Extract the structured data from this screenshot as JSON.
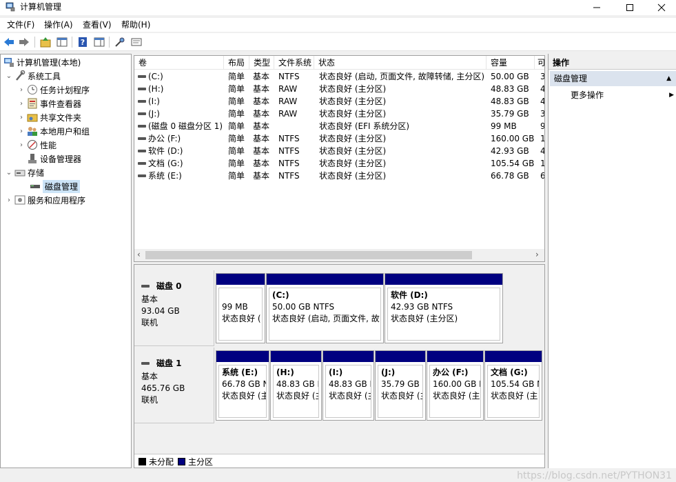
{
  "window": {
    "title": "计算机管理",
    "icon": "computer-management-icon"
  },
  "menu": [
    "文件(F)",
    "操作(A)",
    "查看(V)",
    "帮助(H)"
  ],
  "toolbar": [
    "back-arrow-icon",
    "forward-arrow-icon",
    "up-folder-icon",
    "show-tree-icon",
    "help-icon",
    "show-action-pane-icon",
    "connect-icon",
    "properties-icon"
  ],
  "tree": {
    "root": "计算机管理(本地)",
    "system_tools": "系统工具",
    "task_scheduler": "任务计划程序",
    "event_viewer": "事件查看器",
    "shared_folders": "共享文件夹",
    "local_users": "本地用户和组",
    "performance": "性能",
    "device_manager": "设备管理器",
    "storage": "存储",
    "disk_management": "磁盘管理",
    "services": "服务和应用程序"
  },
  "volumes": {
    "headers": [
      "卷",
      "布局",
      "类型",
      "文件系统",
      "状态",
      "容量",
      "可"
    ],
    "rows": [
      [
        "(C:)",
        "简单",
        "基本",
        "NTFS",
        "状态良好 (启动, 页面文件, 故障转储, 主分区)",
        "50.00 GB",
        "3"
      ],
      [
        "(H:)",
        "简单",
        "基本",
        "RAW",
        "状态良好 (主分区)",
        "48.83 GB",
        "4"
      ],
      [
        "(I:)",
        "简单",
        "基本",
        "RAW",
        "状态良好 (主分区)",
        "48.83 GB",
        "4"
      ],
      [
        "(J:)",
        "简单",
        "基本",
        "RAW",
        "状态良好 (主分区)",
        "35.79 GB",
        "3"
      ],
      [
        "(磁盘 0 磁盘分区 1)",
        "简单",
        "基本",
        "",
        "状态良好 (EFI 系统分区)",
        "99 MB",
        "9"
      ],
      [
        "办公 (F:)",
        "简单",
        "基本",
        "NTFS",
        "状态良好 (主分区)",
        "160.00 GB",
        "1"
      ],
      [
        "软件 (D:)",
        "简单",
        "基本",
        "NTFS",
        "状态良好 (主分区)",
        "42.93 GB",
        "4"
      ],
      [
        "文档 (G:)",
        "简单",
        "基本",
        "NTFS",
        "状态良好 (主分区)",
        "105.54 GB",
        "1"
      ],
      [
        "系统 (E:)",
        "简单",
        "基本",
        "NTFS",
        "状态良好 (主分区)",
        "66.78 GB",
        "6"
      ]
    ]
  },
  "disks": [
    {
      "name": "磁盘 0",
      "type": "基本",
      "size": "93.04 GB",
      "status": "联机",
      "partitions": [
        {
          "name": "",
          "size": "99 MB",
          "status": "状态良好 ("
        },
        {
          "name": "(C:)",
          "size": "50.00 GB NTFS",
          "status": "状态良好 (启动, 页面文件, 故"
        },
        {
          "name": "软件  (D:)",
          "size": "42.93 GB NTFS",
          "status": "状态良好 (主分区)"
        }
      ]
    },
    {
      "name": "磁盘 1",
      "type": "基本",
      "size": "465.76 GB",
      "status": "联机",
      "partitions": [
        {
          "name": "系统  (E:)",
          "size": "66.78 GB N",
          "status": "状态良好 (主"
        },
        {
          "name": "(H:)",
          "size": "48.83 GB F",
          "status": "状态良好 (主"
        },
        {
          "name": "(I:)",
          "size": "48.83 GB F",
          "status": "状态良好 (主"
        },
        {
          "name": "(J:)",
          "size": "35.79 GB I",
          "status": "状态良好 (主"
        },
        {
          "name": "办公  (F:)",
          "size": "160.00 GB N",
          "status": "状态良好 (主"
        },
        {
          "name": "文档  (G:)",
          "size": "105.54 GB N",
          "status": "状态良好 (主"
        }
      ]
    }
  ],
  "legend": {
    "unallocated": "未分配",
    "primary": "主分区",
    "unallocated_color": "#000000",
    "primary_color": "#000080"
  },
  "actions": {
    "header": "操作",
    "group": "磁盘管理",
    "more": "更多操作"
  },
  "watermark": "https://blog.csdn.net/PYTHON31"
}
